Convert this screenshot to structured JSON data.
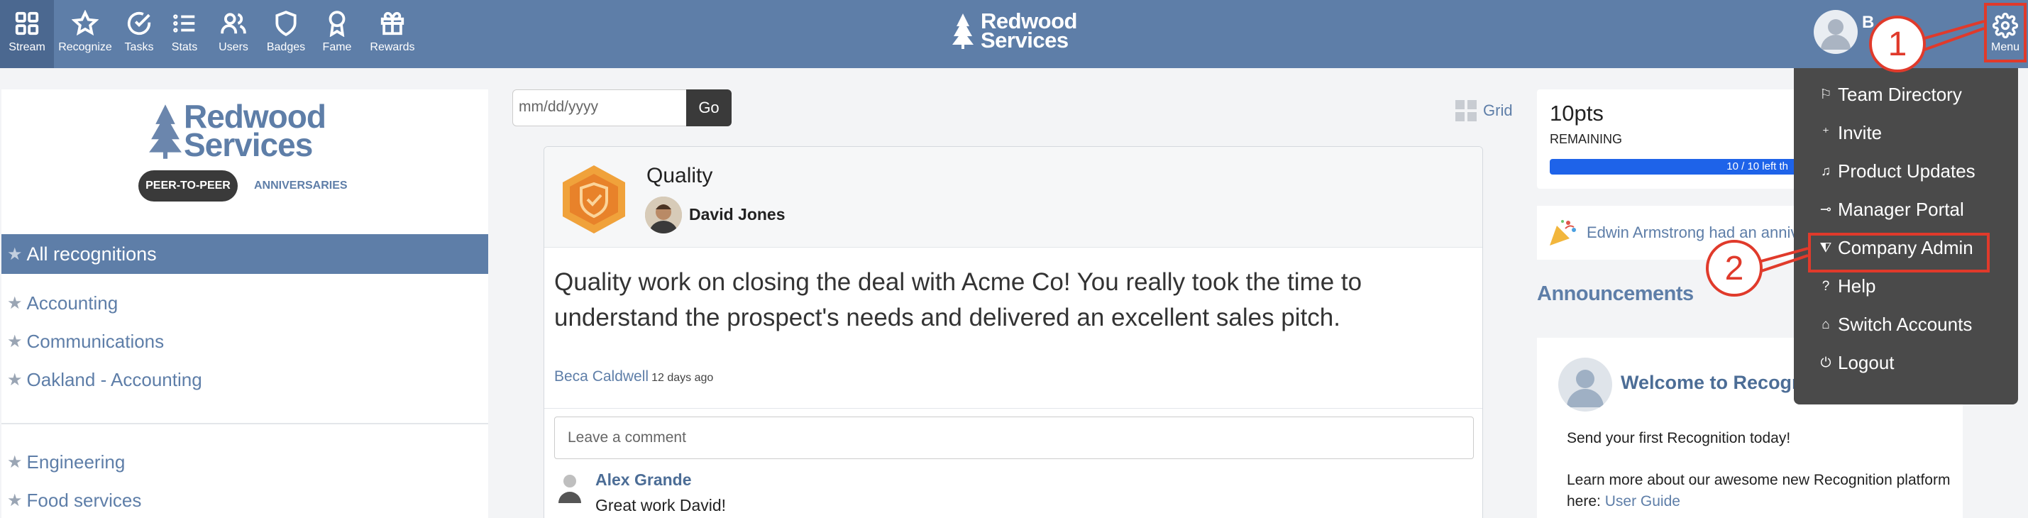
{
  "topnav": {
    "items": [
      {
        "label": "Stream",
        "icon": "grid-icon"
      },
      {
        "label": "Recognize",
        "icon": "star-icon"
      },
      {
        "label": "Tasks",
        "icon": "check-circle-icon"
      },
      {
        "label": "Stats",
        "icon": "list-icon"
      },
      {
        "label": "Users",
        "icon": "users-icon"
      },
      {
        "label": "Badges",
        "icon": "shield-icon"
      },
      {
        "label": "Fame",
        "icon": "award-icon"
      },
      {
        "label": "Rewards",
        "icon": "gift-icon"
      }
    ],
    "brand": "Redwood Services",
    "brand_line1": "Redwood",
    "brand_line2": "Services",
    "user_initials": "B",
    "menu_label": "Menu"
  },
  "callouts": {
    "one": "1",
    "two": "2"
  },
  "left_panel": {
    "logo_line1": "Redwood",
    "logo_line2": "Services",
    "tab_active": "PEER-TO-PEER",
    "tab_other": "ANNIVERSARIES",
    "all_recognitions": "All recognitions",
    "categories_a": [
      "Accounting",
      "Communications",
      "Oakland - Accounting"
    ],
    "categories_b": [
      "Engineering",
      "Food services"
    ]
  },
  "filter": {
    "date_placeholder": "mm/dd/yyyy",
    "go_label": "Go",
    "grid_label": "Grid"
  },
  "card": {
    "title": "Quality",
    "author": "David Jones",
    "message": "Quality work on closing the deal with Acme Co! You really took the time to understand the prospect's needs and delivered an excellent sales pitch.",
    "giver": "Beca Caldwell",
    "time_ago": "12 days ago",
    "comment_placeholder": "Leave a comment",
    "commenter": "Alex Grande",
    "comment_text": "Great work David!"
  },
  "points": {
    "value": "10pts",
    "label": "REMAINING",
    "progress_text": "10 / 10 left th",
    "progress": 1.0
  },
  "anniversary": {
    "text": "Edwin Armstrong had an anniv"
  },
  "announcements": {
    "heading": "Announcements",
    "welcome_title": "Welcome to Recogni",
    "line1": "Send your first Recognition today!",
    "line2": "Learn more about our awesome new Recognition platform here:",
    "link": "User Guide"
  },
  "dropdown": {
    "items": [
      {
        "label": "Team Directory",
        "icon": "flag-icon"
      },
      {
        "label": "Invite",
        "icon": "user-plus-icon"
      },
      {
        "label": "Product Updates",
        "icon": "bell-icon"
      },
      {
        "label": "Manager Portal",
        "icon": "commit-icon"
      },
      {
        "label": "Company Admin",
        "icon": "sliders-icon"
      },
      {
        "label": "Help",
        "icon": "help-icon"
      },
      {
        "label": "Switch Accounts",
        "icon": "home-icon"
      },
      {
        "label": "Logout",
        "icon": "power-icon"
      }
    ]
  },
  "colors": {
    "topbar": "#5e7ea8",
    "accent": "#5e7ea8",
    "callout": "#e03a2b",
    "dropdown": "#4a4a4a",
    "progress": "#1e63e9"
  }
}
